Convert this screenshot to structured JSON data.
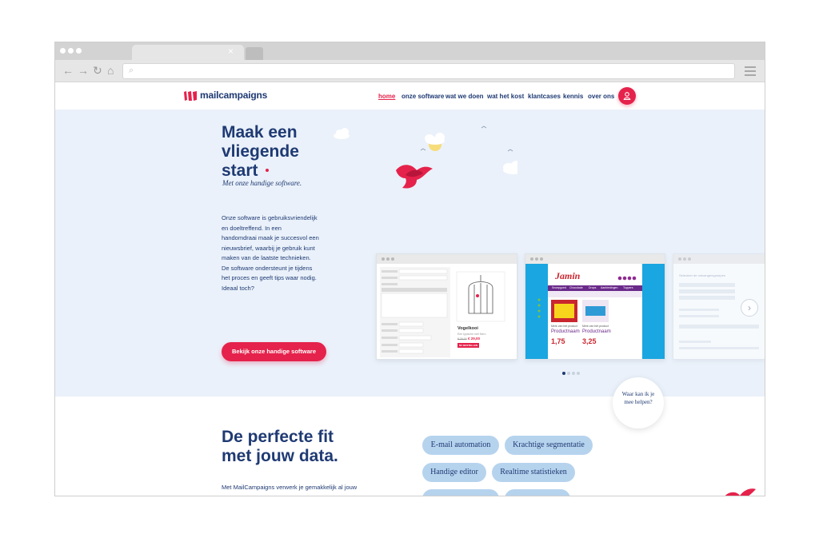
{
  "browser": {
    "tab_close": "×",
    "nav_icons": [
      "back-icon",
      "forward-icon",
      "reload-icon",
      "home-icon"
    ],
    "url_icon": "search-icon"
  },
  "site": {
    "logo_text": "mailcampaigns",
    "nav": [
      {
        "label": "home",
        "active": true
      },
      {
        "label": "onze software",
        "active": false
      },
      {
        "label": "wat we doen",
        "active": false
      },
      {
        "label": "wat het kost",
        "active": false
      },
      {
        "label": "klantcases",
        "active": false
      },
      {
        "label": "kennis",
        "active": false
      },
      {
        "label": "over ons",
        "active": false
      }
    ],
    "user_icon": "user-icon"
  },
  "hero": {
    "title_lines": [
      "Maak een",
      "vliegende",
      "start"
    ],
    "subtitle": "Met onze handige software.",
    "body_lines": [
      "Onze software is gebruiksvriendelijk",
      "en doeltreffend. In een",
      "handomdraai maak je succesvol een",
      "nieuwsbrief, waarbij je gebruik kunt",
      "maken van de laatste technieken.",
      "De software ondersteunt je tijdens",
      "het proces en geeft tips waar nodig.",
      "Ideaal toch?"
    ],
    "cta": "Bekijk onze handige software",
    "slider": {
      "pages": 4,
      "active": 0
    }
  },
  "shots": {
    "editor": {
      "product_name": "Vogelkooi",
      "product_sub": "Een typische met Nero",
      "price_old": "€ 39,00",
      "price_new": "€ 29,00",
      "button": "NU BESTELLEN"
    },
    "newsletter": {
      "brand": "Jamin",
      "menu": [
        "Snoepgoed",
        "Chocolade",
        "Drops",
        "Aanbiedingen",
        "Toppers"
      ],
      "product_label": "Merk van het product",
      "product_name": "Productnaam",
      "price1": "1,75",
      "price2": "3,25"
    },
    "groups": {
      "title": "Selecteer de ontvangersgroepen"
    }
  },
  "section2": {
    "title_lines": [
      "De perfecte fit",
      "met jouw data."
    ],
    "body": "Met MailCampaigns verwerk je gemakkelijk al jouw",
    "pills": [
      "E-mail automation",
      "Krachtige segmentatie",
      "Handige editor",
      "Realtime statistieken"
    ],
    "chat": [
      "Waar kan ik je",
      "mee helpen?"
    ]
  },
  "colors": {
    "brand_navy": "#1f3a73",
    "brand_red": "#e5224b",
    "hero_bg": "#eaf1fa",
    "pill_bg": "#b6d3ee"
  }
}
